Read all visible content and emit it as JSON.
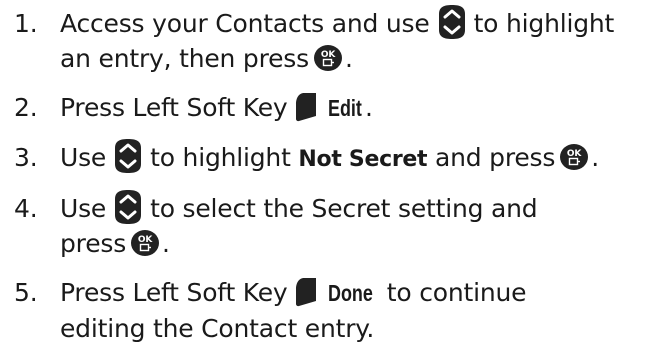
{
  "steps": [
    {
      "number": "1.",
      "line1_a": "Access your Contacts and use",
      "line1_b": "to highlight",
      "line2_a": "an entry, then press",
      "line2_b": "."
    },
    {
      "number": "2.",
      "text_a": "Press Left Soft Key",
      "key_label": "Edit",
      "text_b": "."
    },
    {
      "number": "3.",
      "text_a": "Use",
      "text_b": "to highlight",
      "option": "Not Secret",
      "text_c": "and press",
      "text_d": "."
    },
    {
      "number": "4.",
      "line1_a": "Use",
      "line1_b": "to select the Secret setting and",
      "line2_a": "press",
      "line2_b": "."
    },
    {
      "number": "5.",
      "text_a": "Press Left Soft Key",
      "key_label": "Done",
      "text_b": "to continue",
      "line2": "editing the Contact entry."
    }
  ],
  "icons": {
    "nav_key": "navigation-key-icon",
    "ok_key": "ok-key-icon",
    "left_soft_key": "left-soft-key-icon",
    "ok_key_text": "OK"
  }
}
